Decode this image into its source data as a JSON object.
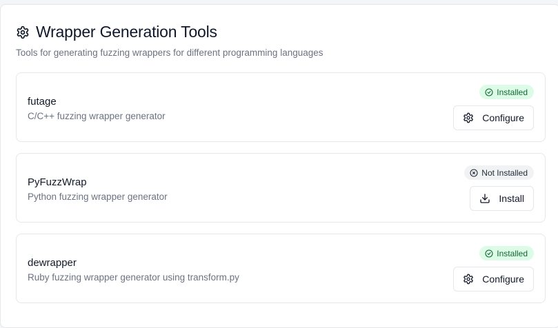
{
  "header": {
    "icon": "gear-icon",
    "title": "Wrapper Generation Tools",
    "subtitle": "Tools for generating fuzzing wrappers for different programming languages"
  },
  "tools": [
    {
      "name": "futage",
      "description": "C/C++ fuzzing wrapper generator",
      "status": "Installed",
      "status_icon": "check-circle-icon",
      "action_label": "Configure",
      "action_icon": "gear-icon"
    },
    {
      "name": "PyFuzzWrap",
      "description": "Python fuzzing wrapper generator",
      "status": "Not Installed",
      "status_icon": "x-circle-icon",
      "action_label": "Install",
      "action_icon": "download-icon"
    },
    {
      "name": "dewrapper",
      "description": "Ruby fuzzing wrapper generator using transform.py",
      "status": "Installed",
      "status_icon": "check-circle-icon",
      "action_label": "Configure",
      "action_icon": "gear-icon"
    }
  ],
  "colors": {
    "installed_bg": "#dcfce7",
    "installed_text": "#166534",
    "not_installed_bg": "#f1f2f4",
    "muted_text": "#6b7280",
    "border": "#e5e7eb"
  }
}
